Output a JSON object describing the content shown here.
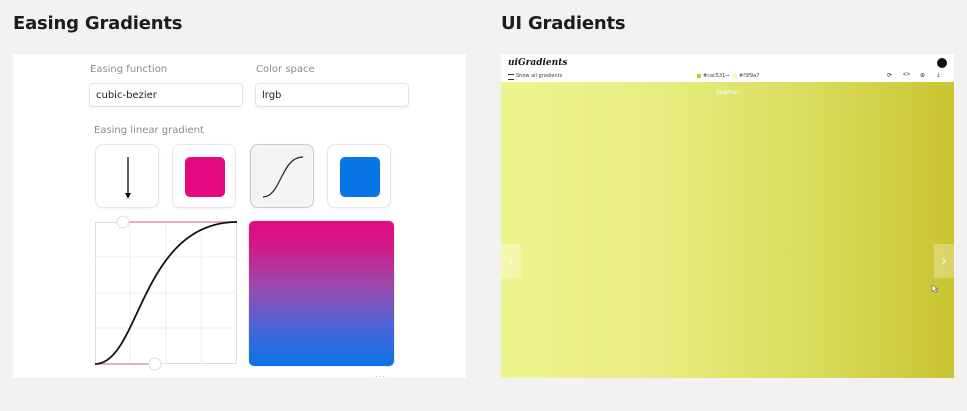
{
  "easing": {
    "title": "Easing Gradients",
    "easing_function_label": "Easing function",
    "easing_function_value": "cubic-bezier",
    "color_space_label": "Color space",
    "color_space_value": "lrgb",
    "gradient_label": "Easing linear gradient",
    "colors": {
      "start": "#e5097f",
      "end": "#0a73e6"
    },
    "more": "···"
  },
  "ui": {
    "title": "UI Gradients",
    "logo": "uiGradients",
    "show_all": "Show all gradients",
    "color_a": "#cac531",
    "color_b": "#f3f9a7",
    "color_a_label": "#cac531",
    "color_b_label": "#f3f9a7",
    "gradient_name": "Sulphur",
    "prev_icon": "chevron-left-icon",
    "next_icon": "chevron-right-icon"
  }
}
